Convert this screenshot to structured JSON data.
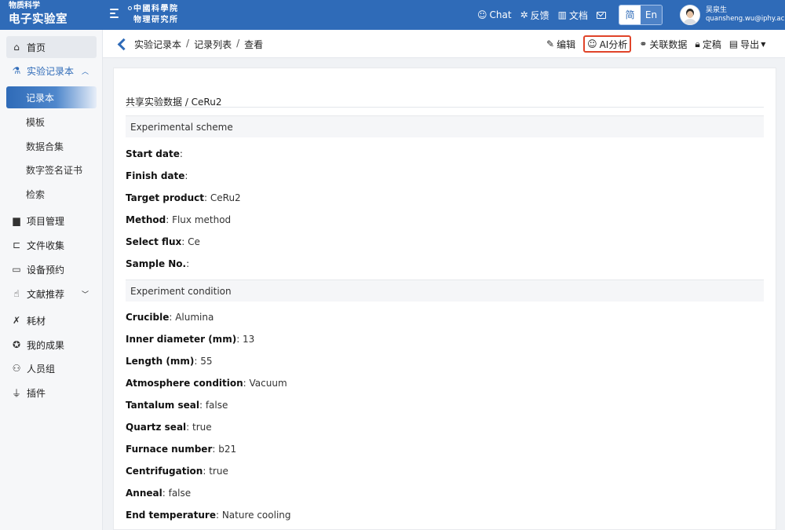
{
  "brand": {
    "subtitle": "物质科学",
    "title": "电子实验室"
  },
  "institution": {
    "line1": "中國科學院",
    "line2": "物理研究所"
  },
  "topbar": {
    "chat": "Chat",
    "feedback": "反馈",
    "docs": "文档",
    "lang_cn": "简",
    "lang_en": "En"
  },
  "user": {
    "name": "吴泉生",
    "email": "quansheng.wu@iphy.ac.cn"
  },
  "sidebar": {
    "home": "首页",
    "notebook": "实验记录本",
    "sub": [
      "记录本",
      "模板",
      "数据合集",
      "数字签名证书",
      "检索"
    ],
    "items": [
      "项目管理",
      "文件收集",
      "设备预约",
      "文献推荐",
      "耗材",
      "我的成果",
      "人员组",
      "插件"
    ]
  },
  "breadcrumb": {
    "c1": "实验记录本",
    "sep": "/",
    "c2": "记录列表",
    "c3": "查看"
  },
  "actions": {
    "edit": "编辑",
    "ai": "AI分析",
    "linked": "关联数据",
    "finalize": "定稿",
    "export": "导出"
  },
  "record": {
    "title": "共享实验数据 / CeRu2",
    "section1": "Experimental scheme",
    "section2": "Experiment condition",
    "scheme": [
      {
        "label": "Start date",
        "value": ""
      },
      {
        "label": "Finish date",
        "value": ""
      },
      {
        "label": "Target product",
        "value": " CeRu2"
      },
      {
        "label": "Method",
        "value": " Flux method"
      },
      {
        "label": "Select flux",
        "value": " Ce"
      },
      {
        "label": "Sample No.",
        "value": ""
      }
    ],
    "condition": [
      {
        "label": "Crucible",
        "value": " Alumina"
      },
      {
        "label": "Inner diameter (mm)",
        "value": " 13"
      },
      {
        "label": "Length (mm)",
        "value": " 55"
      },
      {
        "label": "Atmosphere condition",
        "value": " Vacuum"
      },
      {
        "label": "Tantalum seal",
        "value": " false"
      },
      {
        "label": "Quartz seal",
        "value": " true"
      },
      {
        "label": "Furnace number",
        "value": " b21"
      },
      {
        "label": "Centrifugation",
        "value": " true"
      },
      {
        "label": "Anneal",
        "value": " false"
      },
      {
        "label": "End temperature",
        "value": " Nature cooling"
      }
    ]
  }
}
